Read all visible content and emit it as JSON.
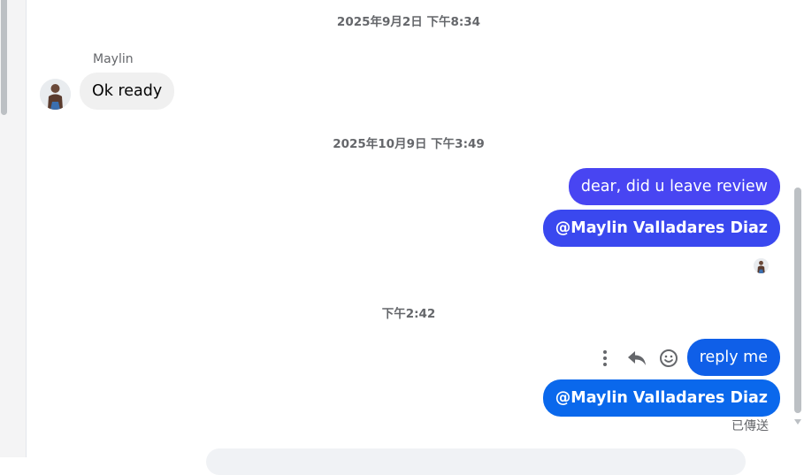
{
  "thread": {
    "timestamps": [
      "2025年9月2日 下午8:34",
      "2025年10月9日 下午3:49",
      "下午2:42"
    ],
    "incoming": {
      "sender": "Maylin",
      "text": "Ok ready",
      "avatar_icon": "user-avatar"
    },
    "outgoing_group_1": [
      {
        "text": "dear, did u leave review",
        "color": "#4845f2"
      },
      {
        "text": "@Maylin Valladares Diaz",
        "color": "#3a48ef"
      }
    ],
    "read_receipt_icon": "user-avatar-small",
    "outgoing_group_2": [
      {
        "text": "reply me",
        "color": "#0f5fe8"
      },
      {
        "text": "@Maylin Valladares Diaz",
        "color": "#0a68ec"
      }
    ],
    "actions": [
      {
        "name": "more-options-icon"
      },
      {
        "name": "reply-icon"
      },
      {
        "name": "react-icon"
      }
    ],
    "status": "已傳送"
  }
}
